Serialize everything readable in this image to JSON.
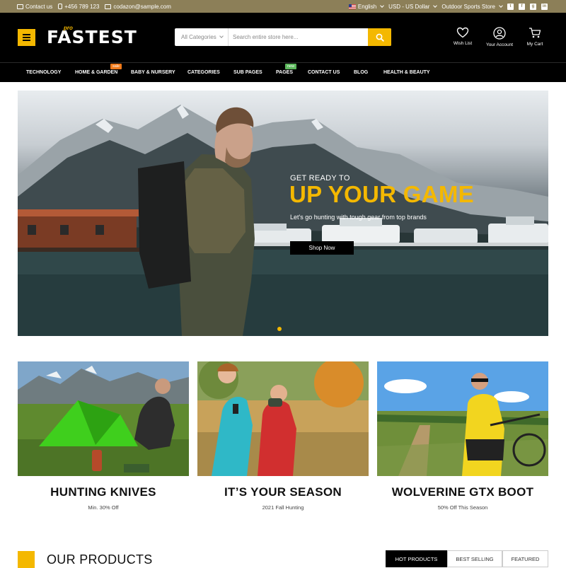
{
  "topbar": {
    "contact": "Contact us",
    "phone": "+456 789 123",
    "email": "codazon@sample.com",
    "language": "English",
    "currency": "USD - US Dollar",
    "store": "Outdoor Sports Store",
    "social": [
      "twitter-icon",
      "facebook-icon",
      "google-plus-icon",
      "linkedin-icon"
    ]
  },
  "header": {
    "logo_text": "FASTEST",
    "logo_sup": "pro",
    "search": {
      "category": "All Categories",
      "placeholder": "Search entire store here..."
    },
    "links": {
      "wishlist": "Wish List",
      "account": "Your Account",
      "cart": "My Cart"
    }
  },
  "nav": {
    "items": [
      {
        "label": "TECHNOLOGY"
      },
      {
        "label": "HOME & GARDEN",
        "badge": "sale"
      },
      {
        "label": "BABY & NURSERY"
      },
      {
        "label": "CATEGORIES"
      },
      {
        "label": "SUB PAGES"
      },
      {
        "label": "PAGES",
        "badge": "new"
      },
      {
        "label": "CONTACT US"
      },
      {
        "label": "BLOG"
      },
      {
        "label": "HEALTH & BEAUTY"
      }
    ]
  },
  "hero": {
    "subtitle": "GET READY TO",
    "title": "UP YOUR GAME",
    "description": "Let's go hunting with tough gear from top brands",
    "button": "Shop Now"
  },
  "promos": [
    {
      "title": "HUNTING KNIVES",
      "subtitle": "Min. 30% Off"
    },
    {
      "title": "IT’S YOUR SEASON",
      "subtitle": "2021 Fall Hunting"
    },
    {
      "title": "WOLVERINE GTX BOOT",
      "subtitle": "50% Off This Season"
    }
  ],
  "products": {
    "title": "OUR PRODUCTS",
    "tabs": [
      "HOT PRODUCTS",
      "BEST SELLING",
      "FEATURED"
    ],
    "active_tab": "HOT PRODUCTS"
  },
  "colors": {
    "accent": "#f4b800",
    "topbar": "#8c7f58",
    "header": "#000000",
    "sale_badge": "#f07a1a",
    "new_badge": "#5cb85c"
  }
}
